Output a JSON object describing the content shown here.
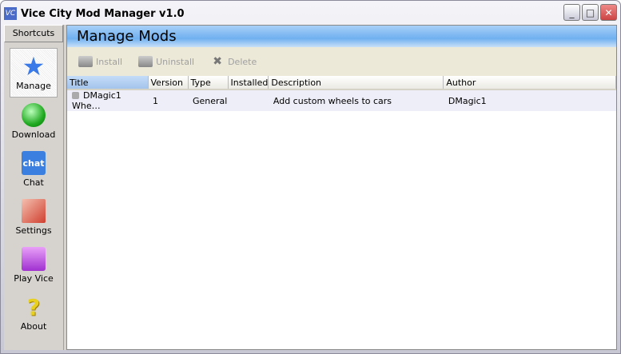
{
  "window": {
    "title": "Vice City Mod Manager v1.0",
    "icon_text": "VC"
  },
  "sidebar": {
    "header": "Shortcuts",
    "items": [
      {
        "label": "Manage",
        "icon": "star-icon"
      },
      {
        "label": "Download",
        "icon": "globe-icon"
      },
      {
        "label": "Chat",
        "icon": "chat-icon",
        "icon_text": "chat"
      },
      {
        "label": "Settings",
        "icon": "settings-icon"
      },
      {
        "label": "Play Vice",
        "icon": "play-icon"
      },
      {
        "label": "About",
        "icon": "question-icon",
        "icon_text": "?"
      }
    ]
  },
  "main": {
    "title": "Manage Mods",
    "toolbar": {
      "install": "Install",
      "uninstall": "Uninstall",
      "delete": "Delete"
    },
    "columns": [
      "Title",
      "Version",
      "Type",
      "Installed",
      "Description",
      "Author"
    ],
    "rows": [
      {
        "title": "DMagic1 Whe…",
        "version": "1",
        "type": "General",
        "installed": "",
        "description": "Add custom wheels to cars",
        "author": "DMagic1"
      }
    ]
  }
}
